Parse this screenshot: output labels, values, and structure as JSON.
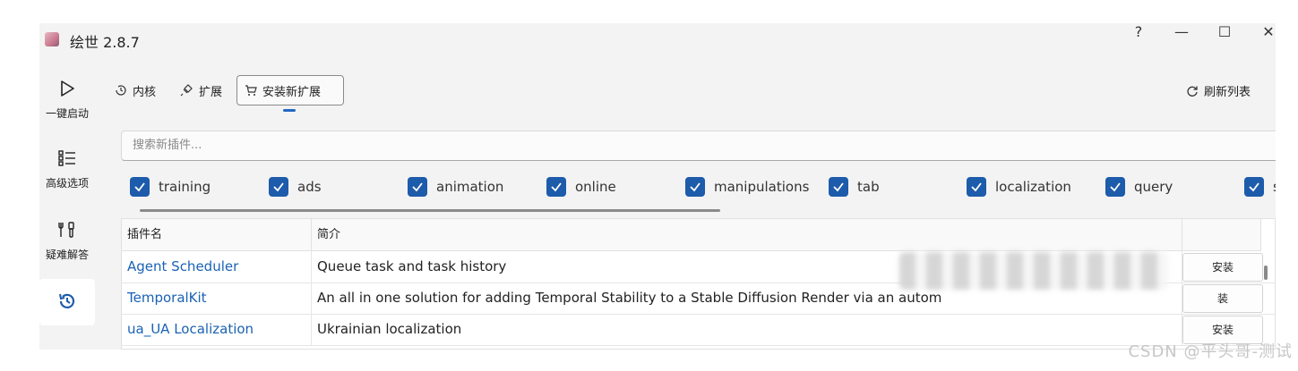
{
  "window": {
    "title": "绘世 2.8.7",
    "controls": {
      "help": "?",
      "minimize": "—",
      "maximize": "☐",
      "close": "✕"
    }
  },
  "sidebar": {
    "items": [
      {
        "label": "一键启动",
        "icon": "play-icon"
      },
      {
        "label": "高级选项",
        "icon": "list-icon"
      },
      {
        "label": "疑难解答",
        "icon": "tools-icon"
      },
      {
        "label": "",
        "icon": "history-icon"
      }
    ]
  },
  "tabs": [
    {
      "label": "内核",
      "icon": "history-icon"
    },
    {
      "label": "扩展",
      "icon": "plug-icon"
    },
    {
      "label": "安装新扩展",
      "icon": "cart-icon",
      "active": true
    }
  ],
  "refresh_label": "刷新列表",
  "search": {
    "placeholder": "搜索新插件..."
  },
  "filters": [
    "training",
    "ads",
    "animation",
    "online",
    "manipulations",
    "tab",
    "localization",
    "query",
    "s"
  ],
  "table": {
    "columns": [
      "插件名",
      "简介"
    ],
    "rows": [
      {
        "name": "Agent Scheduler",
        "desc": "Queue task and task history",
        "action": "安装"
      },
      {
        "name": "TemporalKit",
        "desc": "An all in one solution for adding Temporal Stability to a Stable Diffusion Render via an autom",
        "action": "装"
      },
      {
        "name": "ua_UA Localization",
        "desc": "Ukrainian localization",
        "action": "安装"
      }
    ]
  },
  "watermark": "CSDN @平头哥-测试",
  "colors": {
    "accent": "#1d5bab",
    "link": "#1a62b3"
  }
}
